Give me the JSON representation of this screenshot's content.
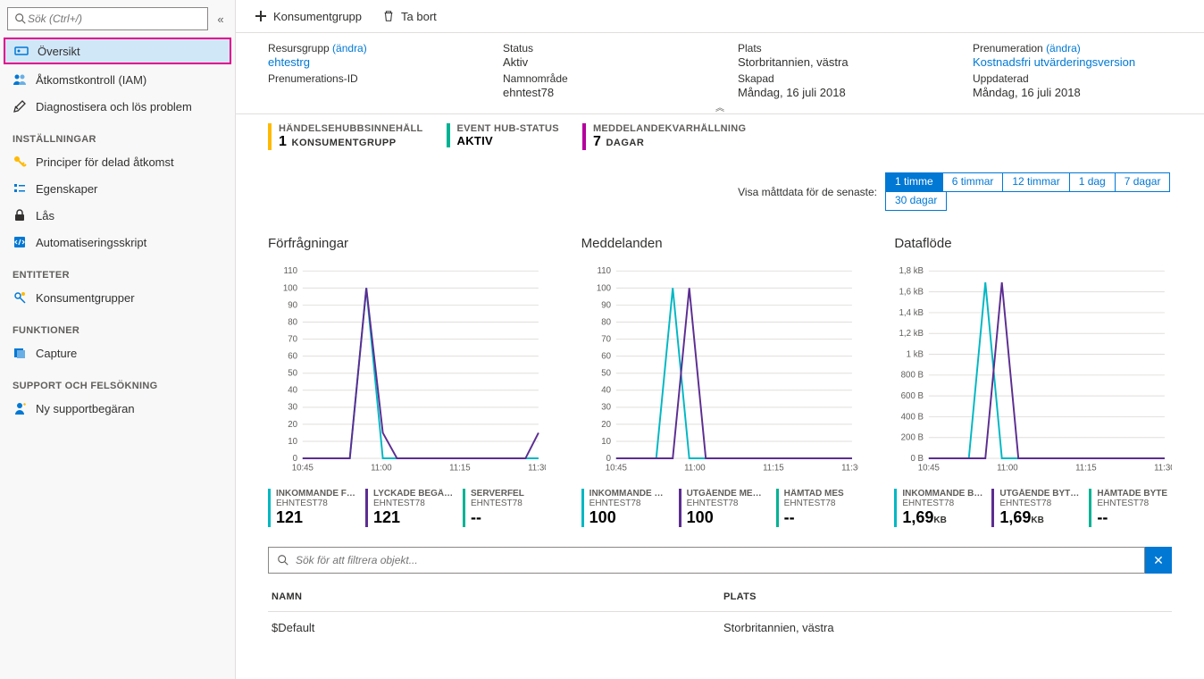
{
  "sidebar": {
    "search_placeholder": "Sök (Ctrl+/)",
    "items": [
      {
        "label": "Översikt",
        "icon": "overview",
        "color": "#0078d4",
        "active": true
      },
      {
        "label": "Åtkomstkontroll (IAM)",
        "icon": "iam",
        "color": "#0078d4"
      },
      {
        "label": "Diagnostisera och lös problem",
        "icon": "diagnose",
        "color": "#323130"
      }
    ],
    "sections": [
      {
        "title": "INSTÄLLNINGAR",
        "items": [
          {
            "label": "Principer för delad åtkomst",
            "icon": "key",
            "color": "#ffb900"
          },
          {
            "label": "Egenskaper",
            "icon": "props",
            "color": "#0078d4"
          },
          {
            "label": "Lås",
            "icon": "lock",
            "color": "#323130"
          },
          {
            "label": "Automatiseringsskript",
            "icon": "script",
            "color": "#0078d4"
          }
        ]
      },
      {
        "title": "ENTITETER",
        "items": [
          {
            "label": "Konsumentgrupper",
            "icon": "consumer",
            "color": "#0078d4"
          }
        ]
      },
      {
        "title": "FUNKTIONER",
        "items": [
          {
            "label": "Capture",
            "icon": "capture",
            "color": "#0078d4"
          }
        ]
      },
      {
        "title": "SUPPORT OCH FELSÖKNING",
        "items": [
          {
            "label": "Ny supportbegäran",
            "icon": "support",
            "color": "#0078d4"
          }
        ]
      }
    ]
  },
  "toolbar": {
    "add_consumer": "Konsumentgrupp",
    "delete": "Ta bort"
  },
  "essentials": {
    "resource_group_label": "Resursgrupp",
    "change_link": "(ändra)",
    "resource_group": "ehtestrg",
    "subscription_id_label": "Prenumerations-ID",
    "status_label": "Status",
    "status": "Aktiv",
    "namespace_label": "Namnområde",
    "namespace": "ehntest78",
    "location_label": "Plats",
    "location": "Storbritannien, västra",
    "created_label": "Skapad",
    "created": "Måndag, 16 juli 2018",
    "subscription_label": "Prenumeration",
    "subscription": "Kostnadsfri utvärderingsversion",
    "updated_label": "Uppdaterad",
    "updated": "Måndag, 16 juli 2018"
  },
  "stats": [
    {
      "label": "HÄNDELSEHUBBSINNEHÅLL",
      "value": "1",
      "sub": "KONSUMENTGRUPP",
      "color": "#ffb900"
    },
    {
      "label": "EVENT HUB-STATUS",
      "value": "AKTIV",
      "sub": "",
      "color": "#00b294",
      "textonly": true
    },
    {
      "label": "MEDDELANDEKVARHÅLLNING",
      "value": "7",
      "sub": "DAGAR",
      "color": "#b4009e"
    }
  ],
  "timefilter": {
    "label": "Visa måttdata för de senaste:",
    "options": [
      "1 timme",
      "6 timmar",
      "12 timmar",
      "1 dag",
      "7 dagar",
      "30 dagar"
    ],
    "active": "1 timme"
  },
  "chart_data": [
    {
      "title": "Förfrågningar",
      "type": "line",
      "x": [
        "10:45",
        "11:00",
        "11:15",
        "11:30"
      ],
      "ylim": [
        0,
        110
      ],
      "yticks": [
        0,
        10,
        20,
        30,
        40,
        50,
        60,
        70,
        80,
        90,
        100,
        110
      ],
      "series": [
        {
          "name": "INKOMMANDE FÖRF...",
          "color": "#00b7c3",
          "values_at_x": [
            0,
            100,
            0,
            0
          ],
          "peak_x_frac": 0.27
        },
        {
          "name": "LYCKADE BEGÄRANDEN",
          "color": "#5c2d91",
          "values_at_x": [
            0,
            100,
            0,
            5
          ],
          "peak_x_frac": 0.27,
          "tail": 15
        }
      ],
      "metrics": [
        {
          "label": "INKOMMANDE FÖRF...",
          "src": "EHNTEST78",
          "value": "121",
          "unit": "",
          "color": "#00b7c3"
        },
        {
          "label": "LYCKADE BEGÄRANDEN",
          "src": "EHNTEST78",
          "value": "121",
          "unit": "",
          "color": "#5c2d91"
        },
        {
          "label": "SERVERFEL",
          "src": "EHNTEST78",
          "value": "--",
          "unit": "",
          "color": "#00b294"
        }
      ]
    },
    {
      "title": "Meddelanden",
      "type": "line",
      "x": [
        "10:45",
        "11:00",
        "11:15",
        "11:30"
      ],
      "ylim": [
        0,
        110
      ],
      "yticks": [
        0,
        10,
        20,
        30,
        40,
        50,
        60,
        70,
        80,
        90,
        100,
        110
      ],
      "series": [
        {
          "name": "INKOMMANDE MED...",
          "color": "#00b7c3",
          "values_at_x": [
            0,
            100,
            0,
            0
          ],
          "peak_x_frac": 0.24
        },
        {
          "name": "UTGÅENDE MEDD...",
          "color": "#5c2d91",
          "values_at_x": [
            0,
            100,
            0,
            0
          ],
          "peak_x_frac": 0.31
        }
      ],
      "metrics": [
        {
          "label": "INKOMMANDE MED...",
          "src": "EHNTEST78",
          "value": "100",
          "unit": "",
          "color": "#00b7c3"
        },
        {
          "label": "UTGÅENDE MEDD...",
          "src": "EHNTEST78",
          "value": "100",
          "unit": "",
          "color": "#5c2d91"
        },
        {
          "label": "HÄMTAD MES",
          "src": "EHNTEST78",
          "value": "--",
          "unit": "",
          "color": "#00b294"
        }
      ]
    },
    {
      "title": "Dataflöde",
      "type": "line",
      "x": [
        "10:45",
        "11:00",
        "11:15",
        "11:30"
      ],
      "ylim_label": [
        "0 B",
        "200 B",
        "400 B",
        "600 B",
        "800 B",
        "1 kB",
        "1,2 kB",
        "1,4 kB",
        "1,6 kB",
        "1,8 kB"
      ],
      "ylim": [
        0,
        1800
      ],
      "series": [
        {
          "name": "INKOMMANDE BYTE (...",
          "color": "#00b7c3",
          "peak": 1690,
          "peak_x_frac": 0.24
        },
        {
          "name": "UTGÅENDE BYTE (...",
          "color": "#5c2d91",
          "peak": 1690,
          "peak_x_frac": 0.31
        }
      ],
      "metrics": [
        {
          "label": "INKOMMANDE BYTE (...",
          "src": "EHNTEST78",
          "value": "1,69",
          "unit": "KB",
          "color": "#00b7c3"
        },
        {
          "label": "UTGÅENDE BYTE (...",
          "src": "EHNTEST78",
          "value": "1,69",
          "unit": "KB",
          "color": "#5c2d91"
        },
        {
          "label": "HÄMTADE BYTE",
          "src": "EHNTEST78",
          "value": "--",
          "unit": "",
          "color": "#00b294"
        }
      ]
    }
  ],
  "filter": {
    "placeholder": "Sök för att filtrera objekt..."
  },
  "table": {
    "columns": [
      "NAMN",
      "PLATS"
    ],
    "rows": [
      {
        "name": "$Default",
        "location": "Storbritannien, västra"
      }
    ]
  }
}
